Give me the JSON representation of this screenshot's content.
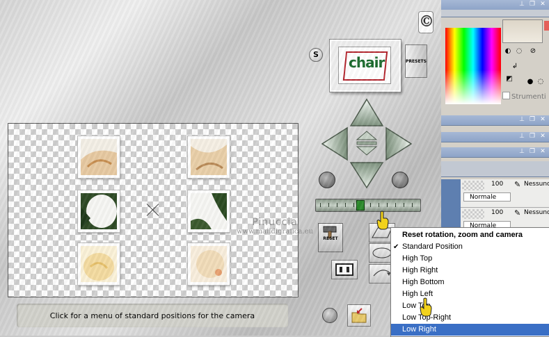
{
  "plugin": {
    "hint_text": "Click for a menu of standard positions for the camera",
    "reset_label": "RESET",
    "presets_label": "PRESETS",
    "s_label": "S",
    "preset_thumb_word": "chair",
    "logo_glyph": "©",
    "zoom_slider_level": 0.42
  },
  "watermark": {
    "line1": "Pinuccia",
    "line2": "www.maildigrafica.eu"
  },
  "camera_menu": {
    "header": "Reset rotation, zoom and camera",
    "items": [
      {
        "label": "Standard Position",
        "checked": true
      },
      {
        "label": "High Top"
      },
      {
        "label": "High Right"
      },
      {
        "label": "High Bottom"
      },
      {
        "label": "High Left"
      },
      {
        "label": "Low Top"
      },
      {
        "label": "Low Top-Right"
      },
      {
        "label": "Low Right",
        "selected": true
      }
    ]
  },
  "host": {
    "strumenti_label": "Strumenti",
    "layers": [
      {
        "opacity": "100",
        "mode": "Normale",
        "blend": "Nessuno"
      },
      {
        "opacity": "100",
        "mode": "Normale",
        "blend": "Nessuno"
      }
    ]
  },
  "colors": {
    "menu_highlight": "#3a6fc5",
    "host_titlebar": "#8ea4c8",
    "swatch_red": "#e4605a"
  }
}
